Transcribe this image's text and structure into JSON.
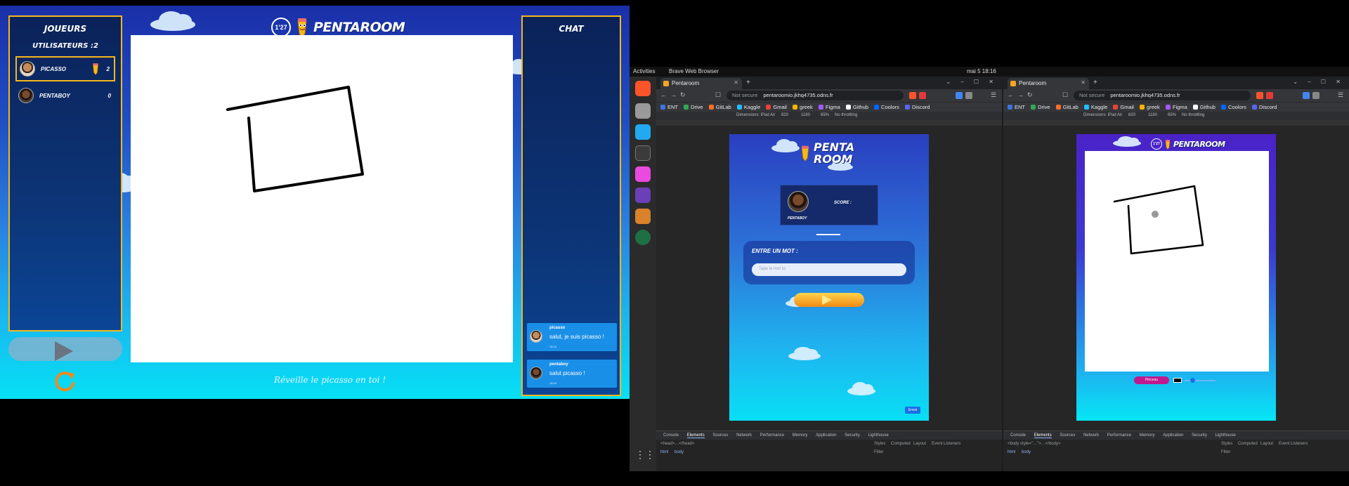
{
  "game": {
    "timer": "1'27",
    "logo": "PENTAROOM",
    "players_title": "JOUEURS",
    "users_count": "UTILISATEURS :2",
    "players": [
      {
        "name": "PICASSO",
        "score": "2",
        "drawing": true
      },
      {
        "name": "PENTABOY",
        "score": "0",
        "drawing": false
      }
    ],
    "chat_title": "CHAT",
    "messages": [
      {
        "user": "picasso",
        "text": "salut, je suis picasso !",
        "time": "18:16"
      },
      {
        "user": "pentaboy",
        "text": "salut picasso !",
        "time": "18:16"
      }
    ],
    "quote": "Réveille le picasso en toi !",
    "colors": {
      "panel_border": "#f5b81c",
      "chat_bubble": "#1a8fe8"
    }
  },
  "desktop": {
    "activities": "Activities",
    "app": "Brave Web Browser",
    "clock": "mai 5  18:16",
    "browsers": [
      {
        "tab": "Pentaroom",
        "url": "pentaroomio.jkhq4735.odns.fr",
        "secure_label": "Not secure",
        "device": "Dimensions: iPad Air",
        "width": "820",
        "height": "1180",
        "zoom": "65%",
        "throttle": "No throttling",
        "mobile": {
          "logo_line1": "PENTA",
          "logo_line2": "ROOM",
          "player": "PENTABOY",
          "score_label": "SCORE :",
          "entry_label": "ENTRE UN MOT :",
          "input_placeholder": "Tape le mot ici",
          "send": "Envoi"
        },
        "dev_filter": "Filter",
        "dev_sub": [
          "Styles",
          "Computed",
          "Layout",
          "Event Listeners"
        ],
        "dev_node": "html",
        "dev_node2": "body",
        "dev_code": "<head>…</head>"
      },
      {
        "tab": "Pentaroom",
        "url": "pentaroomio.jkhq4735.odns.fr",
        "secure_label": "Not secure",
        "device": "Dimensions: iPad Air",
        "width": "820",
        "height": "1180",
        "zoom": "65%",
        "throttle": "No throttling",
        "mobile": {
          "timer": "1'27",
          "logo": "PENTAROOM",
          "pen": "Pinceau"
        },
        "dev_filter": "Filter",
        "dev_sub": [
          "Styles",
          "Computed",
          "Layout",
          "Event Listeners"
        ],
        "dev_node": "html",
        "dev_node2": "body",
        "dev_code": "<body style=\"…\">…</body>"
      }
    ],
    "bookmarks": [
      "ENT",
      "Drive",
      "GitLab",
      "Kaggle",
      "Gmail",
      "greek",
      "Figma",
      "Github",
      "Coolors",
      "Discord"
    ],
    "dev_tabs": [
      "Console",
      "Elements",
      "Sources",
      "Network",
      "Performance",
      "Memory",
      "Application",
      "Security",
      "Lighthouse"
    ]
  }
}
